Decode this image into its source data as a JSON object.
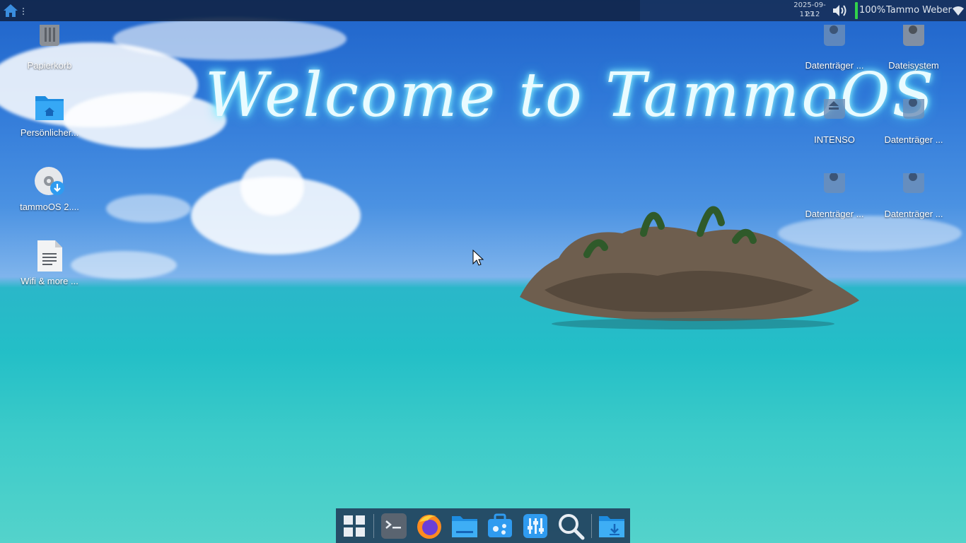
{
  "panel": {
    "date": "2025-09-27",
    "time": "11:12",
    "battery_percent": "100%",
    "user_name": "Tammo Weber",
    "icons": [
      "home-icon",
      "handle-icon",
      "volume-icon",
      "battery-icon",
      "wifi-icon"
    ],
    "battery_color": "#31d14b"
  },
  "wallpaper": {
    "welcome_text": "Welcome to TammoOS",
    "glow_color": "#54e8ff"
  },
  "desktop_left": [
    {
      "label": "Papierkorb",
      "icon": "trash-icon"
    },
    {
      "label": "Persönlicher...",
      "icon": "home-folder-icon"
    },
    {
      "label": "tammoOS 2....",
      "icon": "disc-download-icon"
    },
    {
      "label": "Wifi & more ...",
      "icon": "text-document-icon"
    }
  ],
  "desktop_right": [
    {
      "label": "Datenträger ...",
      "icon": "drive-icon"
    },
    {
      "label": "Dateisystem",
      "icon": "drive-icon"
    },
    {
      "label": "INTENSO",
      "icon": "removable-drive-icon"
    },
    {
      "label": "Datenträger ...",
      "icon": "drive-icon"
    },
    {
      "label": "Datenträger ...",
      "icon": "drive-icon"
    },
    {
      "label": "Datenträger ...",
      "icon": "drive-icon"
    }
  ],
  "dock": {
    "items": [
      "app-grid-icon",
      "terminal-icon",
      "firefox-icon",
      "file-manager-icon",
      "software-center-icon",
      "settings-mixer-icon",
      "search-icon",
      "downloads-folder-icon"
    ]
  }
}
